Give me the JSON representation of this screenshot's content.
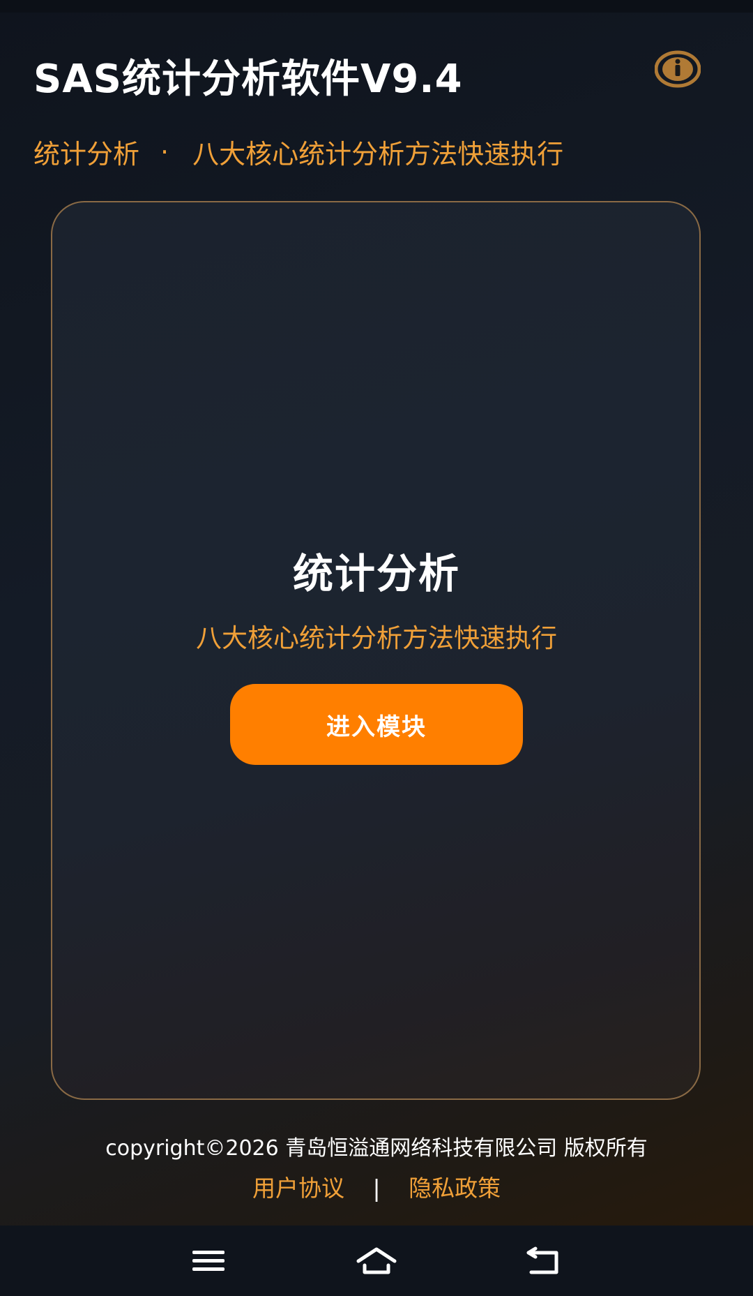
{
  "header": {
    "title": "SAS统计分析软件V9.4",
    "info_icon": "info-circle-icon"
  },
  "tagline": {
    "category": "统计分析",
    "separator": "·",
    "description": "八大核心统计分析方法快速执行"
  },
  "card": {
    "title": "统计分析",
    "subtitle": "八大核心统计分析方法快速执行",
    "button_label": "进入模块"
  },
  "footer": {
    "copyright": "copyright©2026 青岛恒溢通网络科技有限公司 版权所有",
    "user_agreement": "用户协议",
    "separator": "|",
    "privacy_policy": "隐私政策"
  },
  "system_nav": {
    "menu_icon": "menu-icon",
    "home_icon": "home-icon",
    "back_icon": "back-icon"
  },
  "colors": {
    "accent": "#ff7f00",
    "accent_text": "#f0a038",
    "card_border": "#8a6a45",
    "background": "#141b26"
  }
}
